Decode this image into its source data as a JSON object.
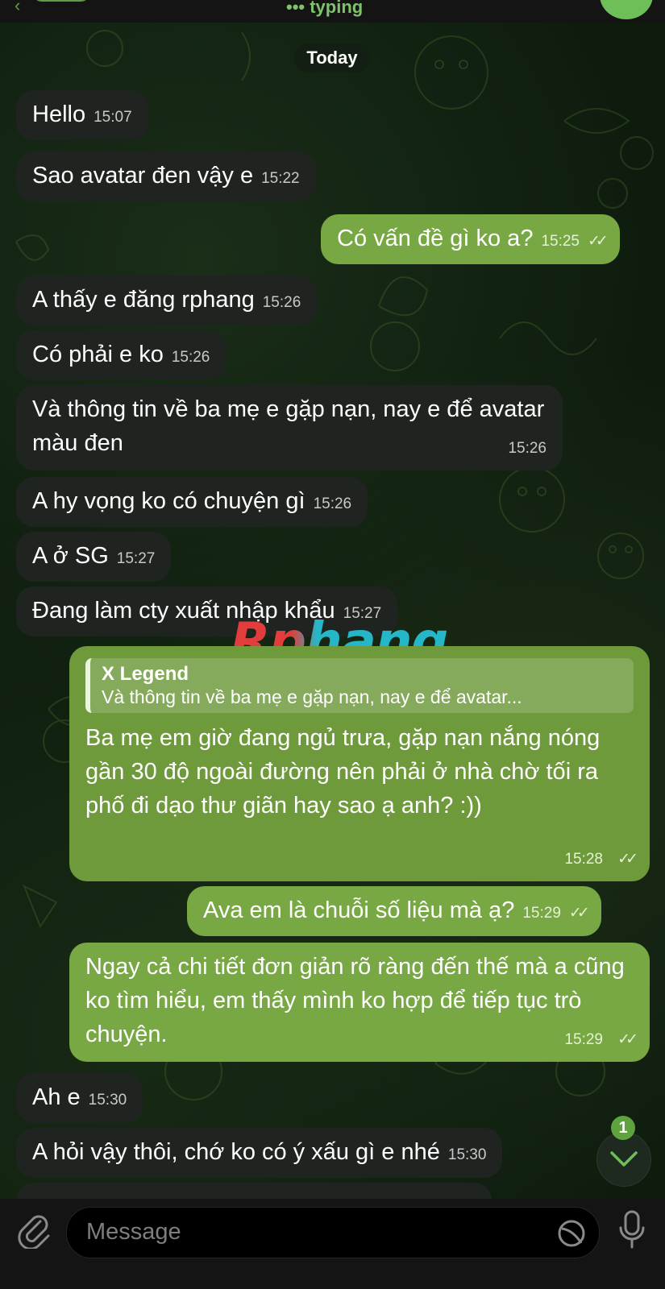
{
  "header": {
    "status": "••• typing"
  },
  "date_chip": "Today",
  "messages": [
    {
      "dir": "in",
      "text": "Hello",
      "time": "15:07"
    },
    {
      "dir": "in",
      "text": "Sao avatar đen vậy e",
      "time": "15:22"
    },
    {
      "dir": "out",
      "text": "Có vấn đề gì ko a?",
      "time": "15:25"
    },
    {
      "dir": "in",
      "text": "A thấy e đăng rphang",
      "time": "15:26"
    },
    {
      "dir": "in",
      "text": "Có phải e ko",
      "time": "15:26"
    },
    {
      "dir": "in",
      "text": "Và thông tin về ba mẹ e gặp nạn, nay e để avatar màu đen",
      "time": "15:26"
    },
    {
      "dir": "in",
      "text": "A hy vọng ko có chuyện gì",
      "time": "15:26"
    },
    {
      "dir": "in",
      "text": "A ở SG",
      "time": "15:27"
    },
    {
      "dir": "in",
      "text": "Đang làm cty xuất nhập khẩu",
      "time": "15:27"
    },
    {
      "dir": "out",
      "reply_name": "X Legend",
      "reply_text": "Và thông tin về ba mẹ e gặp nạn, nay e để avatar...",
      "text": "Ba mẹ em giờ đang ngủ trưa, gặp nạn nắng nóng gần 30 độ ngoài đường nên phải ở nhà chờ tối ra phố đi dạo thư giãn hay sao ạ anh? :))",
      "time": "15:28"
    },
    {
      "dir": "out",
      "text": "Ava em là chuỗi số liệu mà ạ?",
      "time": "15:29"
    },
    {
      "dir": "out",
      "text": "Ngay cả chi tiết đơn giản rõ ràng đến thế mà a cũng ko tìm hiểu, em thấy mình ko hợp để tiếp tục trò chuyện.",
      "time": "15:29"
    },
    {
      "dir": "in",
      "text": "Ah e",
      "time": "15:30"
    },
    {
      "dir": "in",
      "text": "A hỏi vậy thôi, chớ ko có ý xấu gì e nhé",
      "time": "15:30"
    }
  ],
  "watermark": "Rphang",
  "scroll_badge": "1",
  "composer": {
    "placeholder": "Message"
  }
}
